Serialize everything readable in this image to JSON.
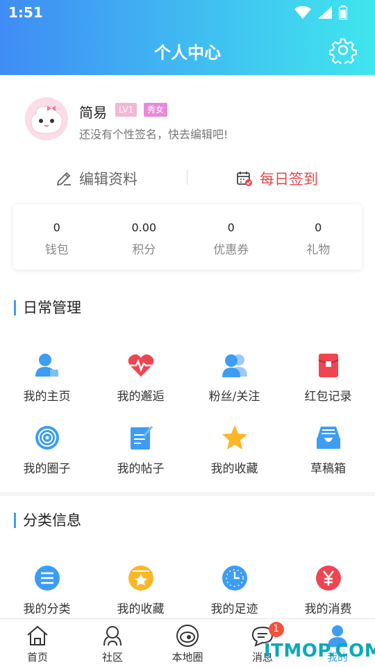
{
  "status_bar": {
    "time": "1:51"
  },
  "header": {
    "title": "个人中心"
  },
  "profile": {
    "name": "简易",
    "level": "LV1",
    "tag": "秀女",
    "signature": "还没有个性签名，快去编辑吧!",
    "edit_label": "编辑资料",
    "signin_label": "每日签到"
  },
  "stats": [
    {
      "value": "0",
      "label": "钱包"
    },
    {
      "value": "0.00",
      "label": "积分"
    },
    {
      "value": "0",
      "label": "优惠券"
    },
    {
      "value": "0",
      "label": "礼物"
    }
  ],
  "daily": {
    "title": "日常管理",
    "items": [
      {
        "label": "我的主页",
        "icon": "user-home-icon"
      },
      {
        "label": "我的邂逅",
        "icon": "heart-pulse-icon"
      },
      {
        "label": "粉丝/关注",
        "icon": "fans-icon"
      },
      {
        "label": "红包记录",
        "icon": "red-envelope-icon"
      },
      {
        "label": "我的圈子",
        "icon": "circle-target-icon"
      },
      {
        "label": "我的帖子",
        "icon": "post-edit-icon"
      },
      {
        "label": "我的收藏",
        "icon": "star-icon"
      },
      {
        "label": "草稿箱",
        "icon": "drafts-tray-icon"
      }
    ]
  },
  "category": {
    "title": "分类信息",
    "items": [
      {
        "label": "我的分类",
        "icon": "list-icon"
      },
      {
        "label": "我的收藏",
        "icon": "star-badge-icon"
      },
      {
        "label": "我的足迹",
        "icon": "clock-icon"
      },
      {
        "label": "我的消费",
        "icon": "yuan-icon"
      }
    ]
  },
  "tabs": [
    {
      "label": "首页",
      "icon": "home-icon"
    },
    {
      "label": "社区",
      "icon": "community-icon"
    },
    {
      "label": "本地圈",
      "icon": "local-circle-icon"
    },
    {
      "label": "消息",
      "icon": "message-icon",
      "badge": "1"
    },
    {
      "label": "我的",
      "icon": "profile-icon"
    }
  ],
  "watermark": "ITMOP.COM",
  "colors": {
    "accent": "#3d9df3",
    "signin": "#e8474b",
    "badge": "#f3533c"
  }
}
